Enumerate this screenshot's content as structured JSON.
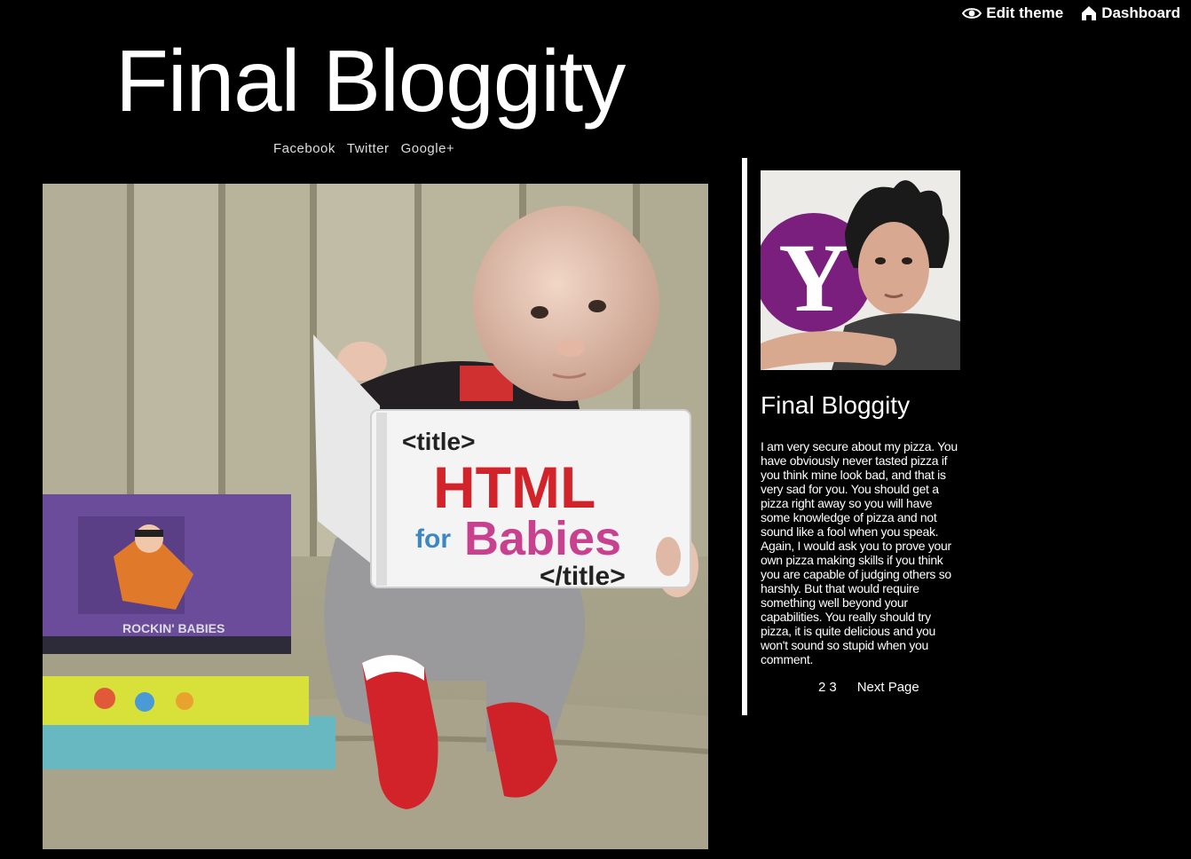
{
  "controls": {
    "edit_theme": "Edit theme",
    "dashboard": "Dashboard",
    "edit_icon": "eye-icon",
    "dashboard_icon": "home-icon"
  },
  "blog": {
    "title": "Final Bloggity"
  },
  "social": {
    "items": [
      "Facebook",
      "Twitter",
      "Google+"
    ]
  },
  "post": {
    "photo_icon": "baby-reading-html-book-photo",
    "book_lines": [
      "<title>",
      "HTML",
      "for",
      "Babies",
      "</title>"
    ]
  },
  "sidebar": {
    "avatar_icon": "profile-photo",
    "avatar_logo_letter": "Y",
    "title": "Final Bloggity",
    "description": "I am very secure about my pizza. You have obviously never tasted pizza if you think mine look bad, and that is very sad for you. You should get a pizza right away so you will have some knowledge of pizza and not sound like a fool when you speak. Again, I would ask you to prove your own pizza making skills if you think you are capable of judging others so harshly. But that would require something well beyond your capabilities. You really should try pizza, it is quite delicious and you won't sound so stupid when you comment."
  },
  "pagination": {
    "pages": [
      "2",
      "3"
    ],
    "next_label": "Next Page"
  },
  "colors": {
    "background": "#000000",
    "text": "#ffffff",
    "divider": "#ffffff",
    "logo_purple": "#7b1f7e"
  }
}
